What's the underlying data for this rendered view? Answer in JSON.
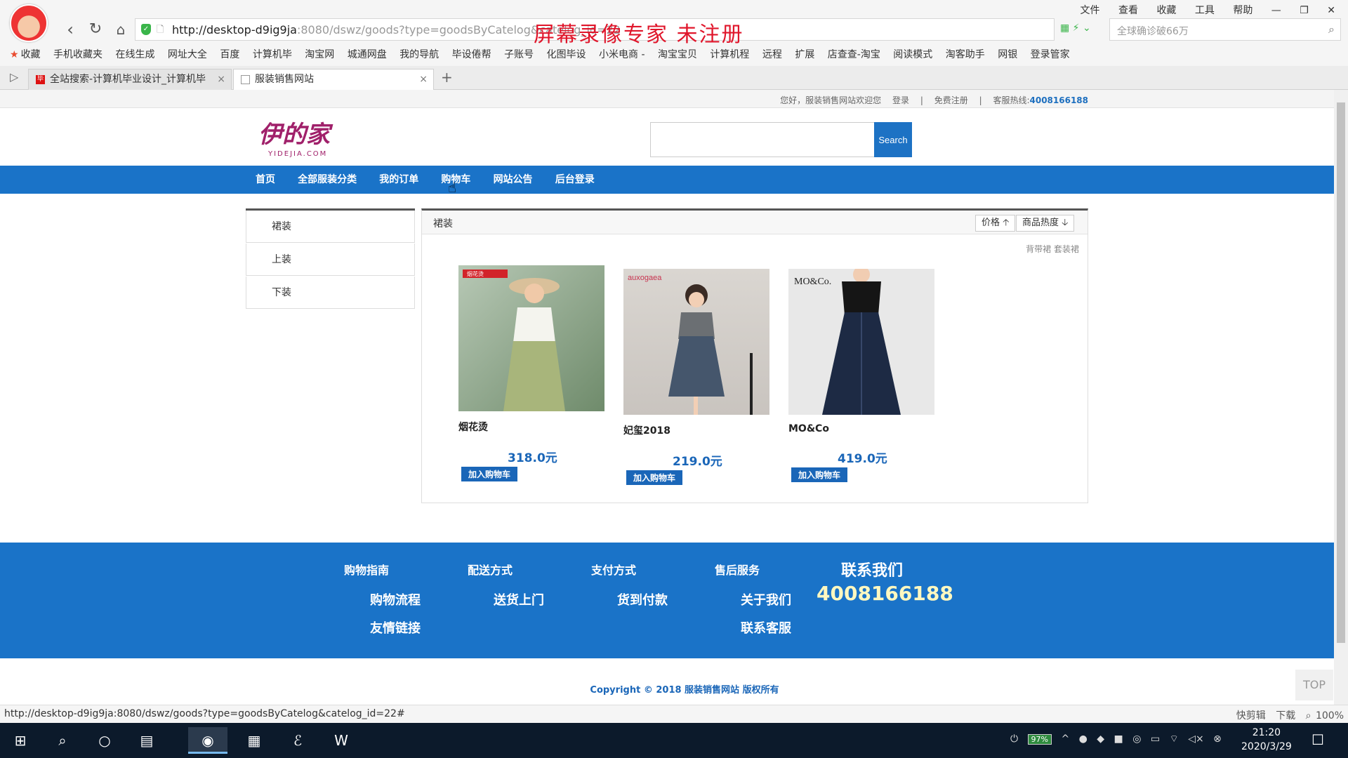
{
  "browser": {
    "url_host": "http://desktop-d9ig9ja",
    "url_rest": ":8080/dswz/goods?type=goodsByCatelog&catelog_id=22",
    "watermark": "屏幕录像专家  未注册",
    "search_placeholder": "全球确诊破66万",
    "menu": [
      "文件",
      "查看",
      "收藏",
      "工具",
      "帮助"
    ],
    "bookmarks": [
      "收藏",
      "手机收藏夹",
      "在线生成",
      "网址大全",
      "百度",
      "计算机毕",
      "淘宝网",
      "城通网盘",
      "我的导航",
      "毕设倦帮",
      "子账号",
      "化图毕设",
      "小米电商 -",
      "淘宝宝贝",
      "计算机程",
      "远程",
      "扩展",
      "店查查-淘宝",
      "阅读模式",
      "淘客助手",
      "网银",
      "登录管家"
    ],
    "tabs": [
      {
        "title": "全站搜索-计算机毕业设计_计算机毕"
      },
      {
        "title": "服装销售网站"
      }
    ],
    "status_url": "http://desktop-d9ig9ja:8080/dswz/goods?type=goodsByCatelog&catelog_id=22#",
    "status_items": [
      "快剪辑",
      "下载",
      "100%"
    ]
  },
  "site": {
    "topbar": {
      "welcome": "您好，服装销售网站欢迎您",
      "login": "登录",
      "register": "免费注册",
      "hotline_label": "客服热线:",
      "hotline": "4008166188"
    },
    "logo": {
      "script": "伊的家",
      "sub": "YIDEJIA.COM"
    },
    "search_button": "Search",
    "nav": [
      "首页",
      "全部服装分类",
      "我的订单",
      "购物车",
      "网站公告",
      "后台登录"
    ],
    "sidebar": [
      "裙装",
      "上装",
      "下装"
    ],
    "content": {
      "title": "裙装",
      "sort_price": "价格 🡡",
      "sort_hot": "商品热度 🡣",
      "tags": "背带裙 套装裙",
      "cart_label": "加入购物车"
    },
    "products": [
      {
        "name": "烟花烫",
        "price": "318.0元",
        "brand_tag": "烟花烫"
      },
      {
        "name": "妃玺2018",
        "price": "219.0元",
        "brand_tag": "auxogaea"
      },
      {
        "name": "MO&Co",
        "price": "419.0元",
        "brand_tag": "MO&Co."
      }
    ],
    "footer": {
      "cols": [
        "购物指南",
        "配送方式",
        "支付方式",
        "售后服务"
      ],
      "links": [
        "购物流程",
        "送货上门",
        "货到付款",
        "关于我们",
        "友情链接",
        "联系客服"
      ],
      "contact_title": "联系我们",
      "hotline": "4008166188"
    },
    "copyright": "Copyright © 2018 服装销售网站 版权所有",
    "top_button": "TOP"
  },
  "taskbar": {
    "battery": "97%",
    "time": "21:20",
    "date": "2020/3/29"
  }
}
